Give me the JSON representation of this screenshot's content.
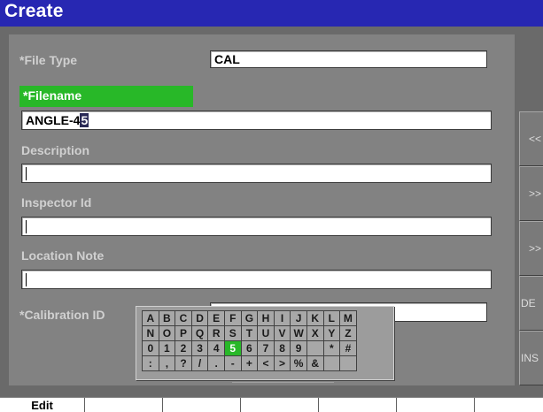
{
  "window": {
    "title": "Create"
  },
  "form": {
    "file_type": {
      "label": "*File Type",
      "value": "CAL"
    },
    "filename": {
      "label": "*Filename",
      "value_before_cursor": "ANGLE-4",
      "cursor_char": "5"
    },
    "description": {
      "label": "Description",
      "value": ""
    },
    "inspector_id": {
      "label": "Inspector Id",
      "value": ""
    },
    "location_note": {
      "label": "Location Note",
      "value": ""
    },
    "calibration_id": {
      "label": "*Calibration ID",
      "value": ""
    }
  },
  "side_buttons": [
    {
      "label": "<<"
    },
    {
      "label": ">>"
    },
    {
      "label": ">>"
    },
    {
      "label": "DE"
    },
    {
      "label": "INS"
    }
  ],
  "keyboard": {
    "selected_key": "5",
    "rows": [
      [
        "A",
        "B",
        "C",
        "D",
        "E",
        "F",
        "G",
        "H",
        "I",
        "J",
        "K",
        "L",
        "M"
      ],
      [
        "N",
        "O",
        "P",
        "Q",
        "R",
        "S",
        "T",
        "U",
        "V",
        "W",
        "X",
        "Y",
        "Z"
      ],
      [
        "0",
        "1",
        "2",
        "3",
        "4",
        "5",
        "6",
        "7",
        "8",
        "9",
        " ",
        "*",
        "#"
      ],
      [
        ":",
        ",",
        "?",
        "/",
        ".",
        "-",
        "+",
        "<",
        ">",
        "%",
        "&",
        " ",
        " "
      ]
    ]
  },
  "tabs": [
    {
      "label": "Edit"
    },
    {
      "label": ""
    },
    {
      "label": ""
    },
    {
      "label": ""
    },
    {
      "label": ""
    },
    {
      "label": ""
    },
    {
      "label": ""
    }
  ],
  "colors": {
    "title_bar": "#2727b2",
    "active_label": "#28b828",
    "background": "#828282"
  }
}
